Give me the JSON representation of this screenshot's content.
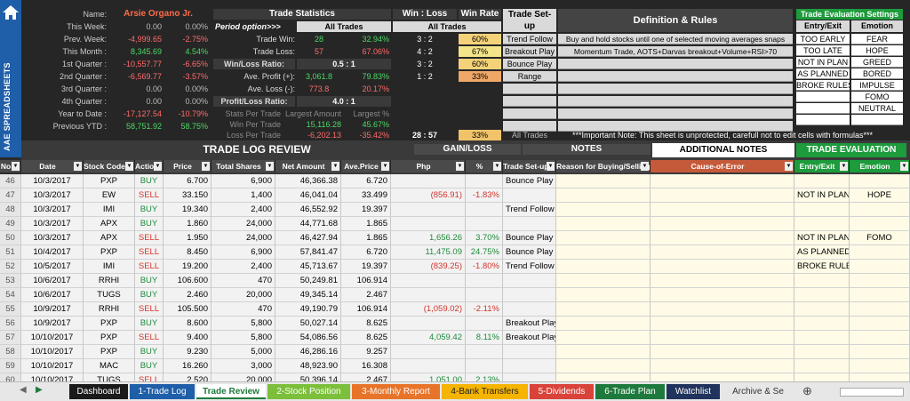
{
  "sidebar": {
    "title": "AAE SPREADSHEETS"
  },
  "summary": {
    "name_label": "Name:",
    "name_value": "Arsie Organo Jr.",
    "rows": [
      {
        "label": "This Week:",
        "amount": "0.00",
        "pct": "0.00%"
      },
      {
        "label": "Prev. Week:",
        "amount": "-4,999.65",
        "pct": "-2.75%"
      },
      {
        "label": "This Month :",
        "amount": "8,345.69",
        "pct": "4.54%"
      },
      {
        "label": "1st Quarter :",
        "amount": "-10,557.77",
        "pct": "-6.65%"
      },
      {
        "label": "2nd Quarter :",
        "amount": "-6,569.77",
        "pct": "-3.57%"
      },
      {
        "label": "3rd Quarter :",
        "amount": "0.00",
        "pct": "0.00%"
      },
      {
        "label": "4th Quarter :",
        "amount": "0.00",
        "pct": "0.00%"
      },
      {
        "label": "Year to Date :",
        "amount": "-17,127.54",
        "pct": "-10.79%"
      },
      {
        "label": "Previous YTD :",
        "amount": "58,751.92",
        "pct": "58.75%"
      }
    ]
  },
  "stats": {
    "title": "Trade Statistics",
    "period_label": "Period option>>>",
    "period_value": "All Trades",
    "trade_win_label": "Trade Win:",
    "trade_win": "28",
    "trade_win_pct": "32.94%",
    "trade_loss_label": "Trade Loss:",
    "trade_loss": "57",
    "trade_loss_pct": "67.06%",
    "wl_ratio_label": "Win/Loss Ratio:",
    "wl_ratio": "0.5 : 1",
    "ave_profit_label": "Ave. Profit (+):",
    "ave_profit": "3,061.8",
    "ave_profit_pct": "79.83%",
    "ave_loss_label": "Ave. Loss (-):",
    "ave_loss": "773.8",
    "ave_loss_pct": "20.17%",
    "pl_ratio_label": "Profit/Loss Ratio:",
    "pl_ratio": "4.0 : 1",
    "stats_per_trade": "Stats Per Trade",
    "largest_amount": "Largest Amount",
    "largest_pct": "Largest %",
    "win_per_trade": "Win Per Trade",
    "win_amt": "15,116.28",
    "win_pct": "45.67%",
    "loss_per_trade": "Loss Per Trade",
    "loss_amt": "-6,202.13",
    "loss_pct": "-35.42%"
  },
  "winloss": {
    "title": "Win : Loss",
    "winrate_title": "Win Rate",
    "all_trades": "All Trades",
    "rows": [
      {
        "wl": "3 : 2",
        "rate": "60%"
      },
      {
        "wl": "4 : 2",
        "rate": "67%"
      },
      {
        "wl": "3 : 2",
        "rate": "60%"
      },
      {
        "wl": "1 : 2",
        "rate": "33%"
      }
    ],
    "total_wl": "28 : 57",
    "total_rate": "33%"
  },
  "setups": {
    "title": "Trade Set-up",
    "items": [
      "Trend Follow",
      "Breakout Play",
      "Bounce Play",
      "Range"
    ],
    "footer": "All Trades"
  },
  "rules": {
    "title": "Definition & Rules",
    "items": [
      "Buy and hold stocks until one of selected moving averages snaps",
      "Momentum Trade, AOTS+Darvas breakout+Volume+RSI>70"
    ],
    "note": "***Important Note: This sheet is unprotected, carefull not to edit cells with formulas***"
  },
  "eval_settings": {
    "title": "Trade Evaluation Settings",
    "entry_title": "Entry/Exit",
    "emotion_title": "Emotion",
    "entry": [
      "TOO EARLY",
      "TOO LATE",
      "NOT IN PLAN",
      "AS PLANNED",
      "BROKE RULES",
      "",
      "",
      ""
    ],
    "emotion": [
      "FEAR",
      "HOPE",
      "GREED",
      "BORED",
      "IMPULSE",
      "FOMO",
      "NEUTRAL",
      ""
    ]
  },
  "log": {
    "section_title": "TRADE LOG REVIEW",
    "gainloss_title": "GAIN/LOSS",
    "notes_title": "NOTES",
    "additional_title": "ADDITIONAL NOTES",
    "eval_title": "TRADE EVALUATION",
    "columns": [
      "No",
      "Date",
      "Stock Code",
      "Action",
      "Price",
      "Total Shares",
      "Net Amount",
      "Ave.Price",
      "Php",
      "%",
      "Trade Set-up",
      "Reason for Buying/Selling",
      "Cause-of-Error",
      "Entry/Exit",
      "Emotion"
    ],
    "rows": [
      {
        "no": "46",
        "date": "10/3/2017",
        "code": "PXP",
        "action": "BUY",
        "price": "6.700",
        "shares": "6,900",
        "net": "46,366.38",
        "ave": "6.720",
        "php": "",
        "pct": "",
        "setup": "Bounce Play",
        "reason": "",
        "cause": "",
        "entry": "",
        "emotion": ""
      },
      {
        "no": "47",
        "date": "10/3/2017",
        "code": "EW",
        "action": "SELL",
        "price": "33.150",
        "shares": "1,400",
        "net": "46,041.04",
        "ave": "33.499",
        "php": "(856.91)",
        "pct": "-1.83%",
        "setup": "",
        "reason": "",
        "cause": "",
        "entry": "NOT IN PLAN",
        "emotion": "HOPE"
      },
      {
        "no": "48",
        "date": "10/3/2017",
        "code": "IMI",
        "action": "BUY",
        "price": "19.340",
        "shares": "2,400",
        "net": "46,552.92",
        "ave": "19.397",
        "php": "",
        "pct": "",
        "setup": "Trend Follow",
        "reason": "",
        "cause": "",
        "entry": "",
        "emotion": ""
      },
      {
        "no": "49",
        "date": "10/3/2017",
        "code": "APX",
        "action": "BUY",
        "price": "1.860",
        "shares": "24,000",
        "net": "44,771.68",
        "ave": "1.865",
        "php": "",
        "pct": "",
        "setup": "",
        "reason": "",
        "cause": "",
        "entry": "",
        "emotion": ""
      },
      {
        "no": "50",
        "date": "10/3/2017",
        "code": "APX",
        "action": "SELL",
        "price": "1.950",
        "shares": "24,000",
        "net": "46,427.94",
        "ave": "1.865",
        "php": "1,656.26",
        "pct": "3.70%",
        "setup": "Bounce Play",
        "reason": "",
        "cause": "",
        "entry": "NOT IN PLAN",
        "emotion": "FOMO"
      },
      {
        "no": "51",
        "date": "10/4/2017",
        "code": "PXP",
        "action": "SELL",
        "price": "8.450",
        "shares": "6,900",
        "net": "57,841.47",
        "ave": "6.720",
        "php": "11,475.09",
        "pct": "24.75%",
        "setup": "Bounce Play",
        "reason": "",
        "cause": "",
        "entry": "AS PLANNED",
        "emotion": ""
      },
      {
        "no": "52",
        "date": "10/5/2017",
        "code": "IMI",
        "action": "SELL",
        "price": "19.200",
        "shares": "2,400",
        "net": "45,713.67",
        "ave": "19.397",
        "php": "(839.25)",
        "pct": "-1.80%",
        "setup": "Trend Follow",
        "reason": "",
        "cause": "",
        "entry": "BROKE RULES",
        "emotion": ""
      },
      {
        "no": "53",
        "date": "10/6/2017",
        "code": "RRHI",
        "action": "BUY",
        "price": "106.600",
        "shares": "470",
        "net": "50,249.81",
        "ave": "106.914",
        "php": "",
        "pct": "",
        "setup": "",
        "reason": "",
        "cause": "",
        "entry": "",
        "emotion": ""
      },
      {
        "no": "54",
        "date": "10/6/2017",
        "code": "TUGS",
        "action": "BUY",
        "price": "2.460",
        "shares": "20,000",
        "net": "49,345.14",
        "ave": "2.467",
        "php": "",
        "pct": "",
        "setup": "",
        "reason": "",
        "cause": "",
        "entry": "",
        "emotion": ""
      },
      {
        "no": "55",
        "date": "10/9/2017",
        "code": "RRHI",
        "action": "SELL",
        "price": "105.500",
        "shares": "470",
        "net": "49,190.79",
        "ave": "106.914",
        "php": "(1,059.02)",
        "pct": "-2.11%",
        "setup": "",
        "reason": "",
        "cause": "",
        "entry": "",
        "emotion": ""
      },
      {
        "no": "56",
        "date": "10/9/2017",
        "code": "PXP",
        "action": "BUY",
        "price": "8.600",
        "shares": "5,800",
        "net": "50,027.14",
        "ave": "8.625",
        "php": "",
        "pct": "",
        "setup": "Breakout Play",
        "reason": "",
        "cause": "",
        "entry": "",
        "emotion": ""
      },
      {
        "no": "57",
        "date": "10/10/2017",
        "code": "PXP",
        "action": "SELL",
        "price": "9.400",
        "shares": "5,800",
        "net": "54,086.56",
        "ave": "8.625",
        "php": "4,059.42",
        "pct": "8.11%",
        "setup": "Breakout Play",
        "reason": "",
        "cause": "",
        "entry": "",
        "emotion": ""
      },
      {
        "no": "58",
        "date": "10/10/2017",
        "code": "PXP",
        "action": "BUY",
        "price": "9.230",
        "shares": "5,000",
        "net": "46,286.16",
        "ave": "9.257",
        "php": "",
        "pct": "",
        "setup": "",
        "reason": "",
        "cause": "",
        "entry": "",
        "emotion": ""
      },
      {
        "no": "59",
        "date": "10/10/2017",
        "code": "MAC",
        "action": "BUY",
        "price": "16.260",
        "shares": "3,000",
        "net": "48,923.90",
        "ave": "16.308",
        "php": "",
        "pct": "",
        "setup": "",
        "reason": "",
        "cause": "",
        "entry": "",
        "emotion": ""
      },
      {
        "no": "60",
        "date": "10/10/2017",
        "code": "TUGS",
        "action": "SELL",
        "price": "2.520",
        "shares": "20,000",
        "net": "50,396.14",
        "ave": "2.467",
        "php": "1,051.00",
        "pct": "2.13%",
        "setup": "",
        "reason": "",
        "cause": "",
        "entry": "",
        "emotion": ""
      }
    ]
  },
  "tabs": [
    {
      "label": "Dashboard",
      "color": "#1a1a1a"
    },
    {
      "label": "1-Trade Log",
      "color": "#1f5ea8"
    },
    {
      "label": "Trade Review",
      "color": "#ffffff"
    },
    {
      "label": "2-Stock Position",
      "color": "#7cbf3a"
    },
    {
      "label": "3-Monthly Report",
      "color": "#e8742a"
    },
    {
      "label": "4-Bank Transfers",
      "color": "#f4b400"
    },
    {
      "label": "5-Dividends",
      "color": "#d9433a"
    },
    {
      "label": "6-Trade Plan",
      "color": "#1e7a3c"
    },
    {
      "label": "Watchlist",
      "color": "#20335c"
    },
    {
      "label": "Archive & Se",
      "color": "#e7e7e7"
    }
  ]
}
